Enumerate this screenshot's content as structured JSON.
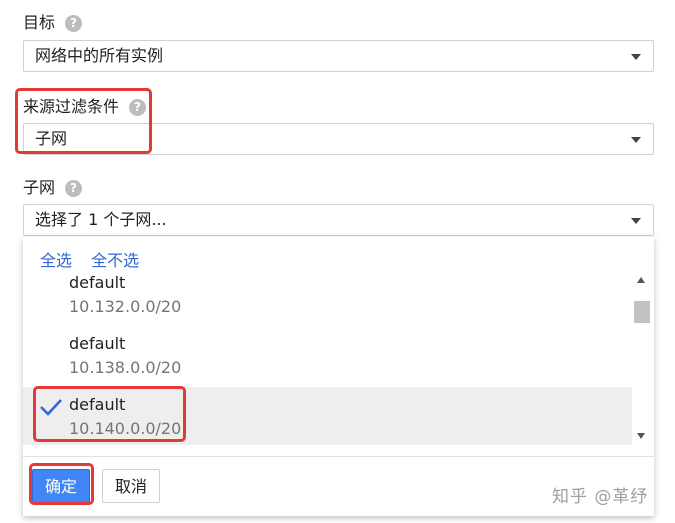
{
  "target": {
    "label": "目标",
    "help_icon": "?",
    "value": "网络中的所有实例"
  },
  "source_filter": {
    "label": "来源过滤条件",
    "help_icon": "?",
    "value": "子网"
  },
  "subnet": {
    "label": "子网",
    "help_icon": "?",
    "value": "选择了 1 个子网..."
  },
  "dropdown": {
    "select_all": "全选",
    "select_none": "全不选",
    "items": [
      {
        "name": "default",
        "cidr": "10.132.0.0/20",
        "selected": false
      },
      {
        "name": "default",
        "cidr": "10.138.0.0/20",
        "selected": false
      },
      {
        "name": "default",
        "cidr": "10.140.0.0/20",
        "selected": true
      }
    ],
    "ok_label": "确定",
    "cancel_label": "取消"
  },
  "watermark": "知乎 @革纾",
  "colors": {
    "highlight": "#e53935",
    "link": "#3367d6",
    "primary_button": "#4285f4",
    "check": "#3367d6"
  }
}
